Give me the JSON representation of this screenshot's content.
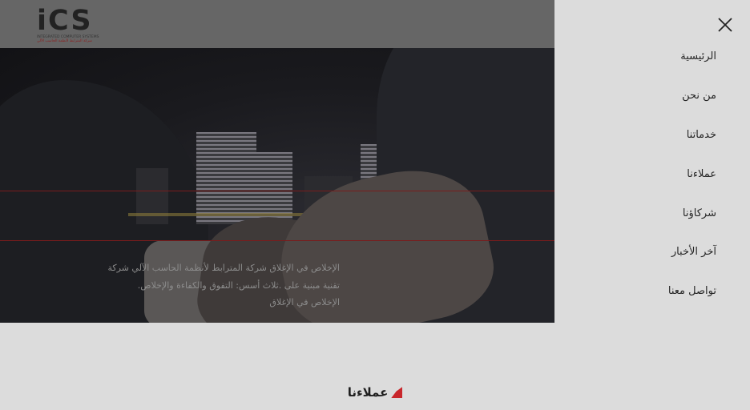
{
  "logo": {
    "mark": "iCS",
    "subtitle_en": "INTEGRATED COMPUTER SYSTEMS",
    "subtitle_ar": "شركة المترابط لأنظمة الحاسب الآلي"
  },
  "hero": {
    "description_lines": [
      "الإخلاص في الإغلاق شركة المترابط لأنظمة الحاسب الآلي شركة",
      "تقنية مبنية على .ثلاث أسس: التفوق والكفاءة والإخلاص.",
      "الإخلاص في الإغلاق"
    ]
  },
  "menu": {
    "close_icon": "close-icon",
    "items": [
      {
        "label": "الرئيسية"
      },
      {
        "label": "من نحن"
      },
      {
        "label": "خدماتنا"
      },
      {
        "label": "عملاءنا"
      },
      {
        "label": "شركاؤنا"
      },
      {
        "label": "آخر الأخبار"
      },
      {
        "label": "تواصل معنا"
      }
    ]
  },
  "section": {
    "title": "عملاءنا"
  },
  "colors": {
    "overlay_header": "#666666",
    "panel_bg": "#dcdcdc",
    "accent_red": "#c8262b"
  }
}
